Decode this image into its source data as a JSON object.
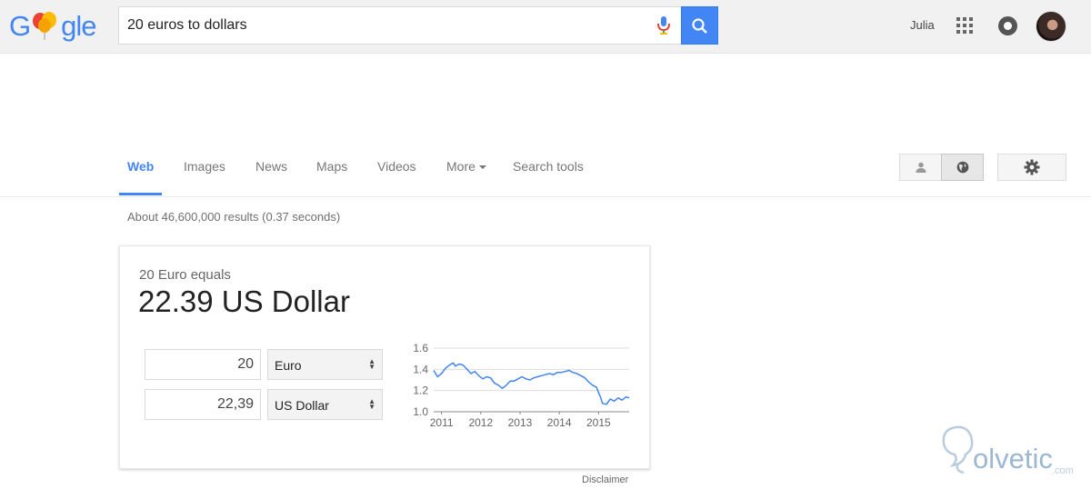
{
  "header": {
    "logo": {
      "p1": "G",
      "p2": "gle"
    },
    "search_value": "20 euros to dollars",
    "user_name": "Julia"
  },
  "tabs": {
    "web": "Web",
    "images": "Images",
    "news": "News",
    "maps": "Maps",
    "videos": "Videos",
    "more": "More",
    "search_tools": "Search tools"
  },
  "result_stats": "About 46,600,000 results (0.37 seconds)",
  "converter": {
    "equals_text": "20 Euro equals",
    "result_text": "22.39 US Dollar",
    "amount_from": "20",
    "currency_from": "Euro",
    "amount_to": "22,39",
    "currency_to": "US Dollar",
    "disclaimer": "Disclaimer"
  },
  "chart_data": {
    "type": "line",
    "x_ticks": [
      "2011",
      "2012",
      "2013",
      "2014",
      "2015"
    ],
    "y_ticks": [
      "1.0",
      "1.2",
      "1.4",
      "1.6"
    ],
    "ylim": [
      1.0,
      1.6
    ],
    "xlim": [
      2010.8,
      2015.78
    ],
    "series": [
      {
        "x": [
          2010.8,
          2010.9,
          2011.0,
          2011.1,
          2011.2,
          2011.3,
          2011.35,
          2011.45,
          2011.55,
          2011.65,
          2011.75,
          2011.85,
          2011.95,
          2012.05,
          2012.15,
          2012.25,
          2012.35,
          2012.45,
          2012.55,
          2012.65,
          2012.75,
          2012.85,
          2012.95,
          2013.05,
          2013.15,
          2013.25,
          2013.35,
          2013.45,
          2013.55,
          2013.65,
          2013.75,
          2013.85,
          2013.95,
          2014.05,
          2014.15,
          2014.25,
          2014.35,
          2014.45,
          2014.55,
          2014.65,
          2014.75,
          2014.85,
          2014.95,
          2015.0,
          2015.05,
          2015.1,
          2015.2,
          2015.3,
          2015.4,
          2015.5,
          2015.6,
          2015.7,
          2015.78
        ],
        "y": [
          1.39,
          1.33,
          1.36,
          1.41,
          1.44,
          1.46,
          1.43,
          1.45,
          1.44,
          1.4,
          1.36,
          1.38,
          1.34,
          1.31,
          1.33,
          1.32,
          1.27,
          1.25,
          1.22,
          1.25,
          1.29,
          1.29,
          1.31,
          1.33,
          1.31,
          1.3,
          1.32,
          1.33,
          1.34,
          1.35,
          1.36,
          1.35,
          1.37,
          1.37,
          1.38,
          1.39,
          1.37,
          1.36,
          1.34,
          1.32,
          1.28,
          1.25,
          1.23,
          1.18,
          1.14,
          1.08,
          1.07,
          1.12,
          1.1,
          1.13,
          1.11,
          1.14,
          1.13
        ]
      }
    ],
    "color": "#4285f4"
  },
  "watermark": {
    "text": "olvetic",
    "suffix": ".com"
  }
}
